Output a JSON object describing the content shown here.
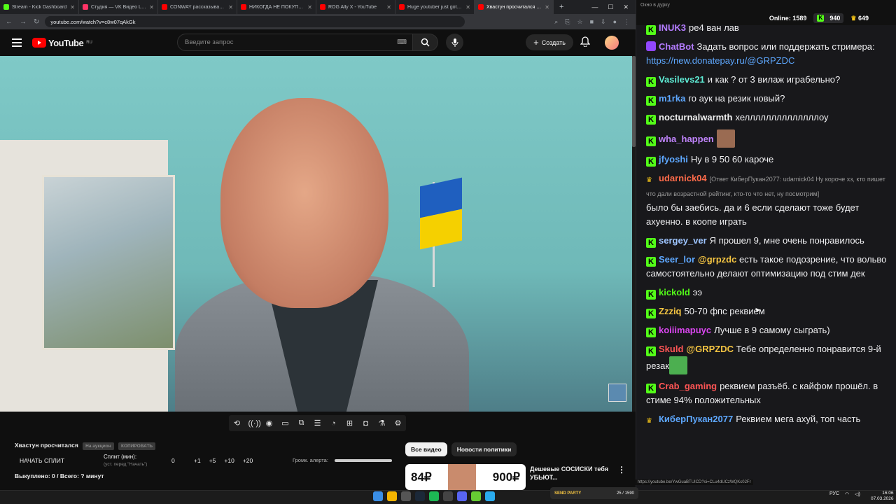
{
  "browser": {
    "tabs": [
      {
        "title": "Stream - Kick Dashboard",
        "color": "#53fc18"
      },
      {
        "title": "Студия — VK Видео Live",
        "color": "#ff3366"
      },
      {
        "title": "CONWAY рассказывает как...",
        "color": "#ff0000"
      },
      {
        "title": "НИКОГДА НЕ ПОКУПАЙ ...",
        "color": "#ff0000"
      },
      {
        "title": "ROG Ally X - YouTube",
        "color": "#ff0000"
      },
      {
        "title": "Huge youtuber just got ban...",
        "color": "#ff0000"
      },
      {
        "title": "Хвастун просчитался - YouTube",
        "color": "#ff0000"
      }
    ],
    "new_tab": "+",
    "url": "youtube.com/watch?v=c8w07qAkGk"
  },
  "youtube": {
    "logo": "YouTube",
    "region": "RU",
    "search_placeholder": "Введите запрос",
    "create_label": "Создать",
    "chips": [
      "Все видео",
      "Новости политики"
    ],
    "recommended": {
      "thumb_left": "84₽",
      "thumb_right": "900₽",
      "title": "Дешевые СОСИСКИ тебя УБЬЮТ..."
    }
  },
  "widget": {
    "title": "Хвастун просчитался",
    "pill1": "На аукцион",
    "pill2": "КОПИРОВАТЬ",
    "start_split": "НАЧАТЬ СПЛИТ",
    "split_label": "Сплит (мин):",
    "split_sub": "(уст. перед \"Начать\")",
    "split_value": "0",
    "steps": [
      "+1",
      "+5",
      "+10",
      "+20"
    ],
    "volume_label": "Громк. алерта:",
    "bought": "Выкуплено: 0 / Всего: ? минут"
  },
  "chat": {
    "window_title": "Окно в дурку",
    "online": "Online: 1589",
    "kick_count": "940",
    "other_count": "649",
    "messages": [
      {
        "nick": "INUK3",
        "color": "#b47cff",
        "text": "ре4 ван лав",
        "badge": "kick"
      },
      {
        "nick": "ChatBot",
        "color": "#b47cff",
        "text": "Задать вопрос или поддержать стримера: ",
        "link": "https://new.donatepay.ru/@GRPZDC",
        "badge": "bot"
      },
      {
        "nick": "Vasilevs21",
        "color": "#5eead4",
        "text": "и как ? от 3 вилаж играбельно?",
        "badge": "kick"
      },
      {
        "nick": "m1rka",
        "color": "#5ea8ff",
        "text": "го аук на резик новый?",
        "badge": "kick"
      },
      {
        "nick": "nocturnalwarmth",
        "color": "#f0f0f0",
        "text": "хеллллллллллллллоу",
        "badge": "kick"
      },
      {
        "nick": "wha_happen",
        "color": "#c084fc",
        "text": "",
        "badge": "kick",
        "emote": "#9a6b52"
      },
      {
        "nick": "jfyoshi",
        "color": "#5ea8ff",
        "text": "Ну в 9 50 60 кароче",
        "badge": "kick"
      },
      {
        "nick": "udarnick04",
        "color": "#ff6b4a",
        "reply": "[Ответ КиберПукан2077: udarnick04 Ну короче хз, кто пишет что дали возрастной рейтинг, кто-то что нет, ну посмотрим]",
        "text": "было бы заебись. да и 6 если сделают тоже будет ахуенно. в коопе играть",
        "badge": "crown"
      },
      {
        "nick": "sergey_ver",
        "color": "#9ec5ff",
        "text": "Я прошел 9, мне очень понравилось",
        "badge": "kick"
      },
      {
        "nick": "Seer_lor",
        "color": "#5ea8ff",
        "mention": "@grpzdc",
        "text": " есть такое подозрение, что вольво самостоятельно делают оптимизацию под стим дек",
        "badge": "kick"
      },
      {
        "nick": "kickold",
        "color": "#53fc18",
        "text": "ээ",
        "badge": "kick"
      },
      {
        "nick": "Zzziq",
        "color": "#f5c542",
        "text": "50-70 фпс реквием",
        "badge": "kick"
      },
      {
        "nick": "koiiimapuyc",
        "color": "#d946ef",
        "text": "Лучше в 9 самому сыграть)",
        "badge": "kick"
      },
      {
        "nick": "Skuld",
        "color": "#ff5555",
        "mention": "@GRPZDC",
        "text": " Тебе определенно понравится 9-й резак",
        "badge": "kick",
        "emote": "#4caf50"
      },
      {
        "nick": "Crab_gaming",
        "color": "#ff5555",
        "text": "реквием разъёб. с кайфом прошёл. в стиме 94% положительных",
        "badge": "kick"
      },
      {
        "nick": "КиберПукан2077",
        "color": "#5ea8ff",
        "text": "Реквием мега ахуй, топ часть",
        "badge": "crown"
      }
    ]
  },
  "statusbar_url": "https://youtube.be/YwGuaBTUICD?si=CLu4dUCzWQKc02Fr",
  "taskbar": {
    "lang": "РУС",
    "time": "16:06",
    "date": "07.03.2026",
    "widget_label": "SEND PARTY",
    "widget_count": "25 / 1590"
  }
}
